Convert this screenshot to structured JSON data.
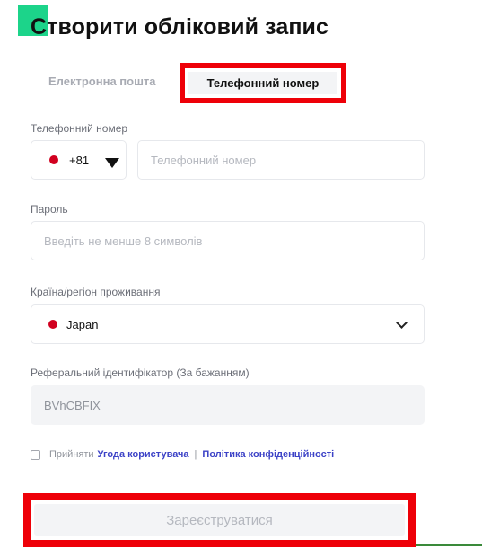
{
  "page": {
    "title": "Створити обліковий запис"
  },
  "tabs": [
    {
      "label": "Електронна пошта",
      "active": false
    },
    {
      "label": "Телефонний номер",
      "active": true
    }
  ],
  "phone": {
    "label": "Телефонний номер",
    "country_code": "+81",
    "placeholder": "Телефонний номер"
  },
  "password": {
    "label": "Пароль",
    "placeholder": "Введіть не менше 8 символів"
  },
  "country": {
    "label": "Країна/регіон проживання",
    "value": "Japan"
  },
  "referral": {
    "label": "Реферальний ідентифікатор (За бажанням)",
    "value": "BVhCBFIX"
  },
  "terms": {
    "accept": "Прийняти",
    "user_agreement": "Угода користувача",
    "separator": "|",
    "privacy_policy": "Політика конфіденційності"
  },
  "submit": {
    "label": "Зареєструватися"
  },
  "colors": {
    "brand": "#1cd48a",
    "highlight": "#ee0008",
    "link": "#3d43c7",
    "flag": "#d1001f"
  },
  "icons": {
    "brand": "brand-logo-square",
    "code_dropdown": "caret-down-icon",
    "country_dropdown": "chevron-down-icon",
    "flag": "japan-flag-icon"
  }
}
